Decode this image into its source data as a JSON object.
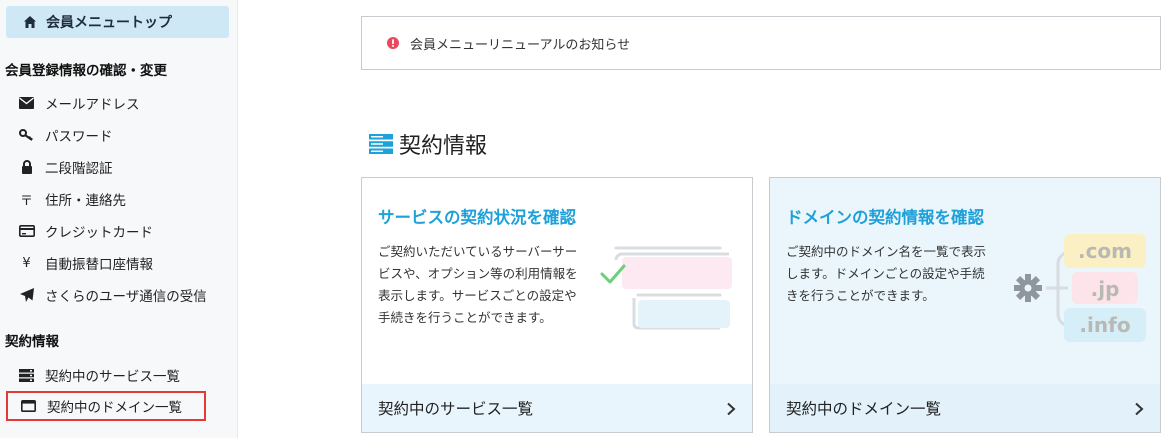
{
  "sidebar": {
    "top": {
      "label": "会員メニュートップ",
      "icon": "home-icon"
    },
    "sections": [
      {
        "heading": "会員登録情報の確認・変更"
      },
      {
        "heading": "契約情報"
      }
    ],
    "account_items": [
      {
        "label": "メールアドレス",
        "icon": "envelope-icon"
      },
      {
        "label": "パスワード",
        "icon": "key-icon"
      },
      {
        "label": "二段階認証",
        "icon": "lock-icon"
      },
      {
        "label": "住所・連絡先",
        "icon": "postal-mark-icon",
        "glyph": "〒"
      },
      {
        "label": "クレジットカード",
        "icon": "credit-card-icon"
      },
      {
        "label": "自動振替口座情報",
        "icon": "yen-icon",
        "glyph": "¥"
      },
      {
        "label": "さくらのユーザ通信の受信",
        "icon": "paper-plane-icon"
      }
    ],
    "contract_items": [
      {
        "label": "契約中のサービス一覧",
        "icon": "server-icon"
      },
      {
        "label": "契約中のドメイン一覧",
        "icon": "window-icon",
        "selected": true
      }
    ]
  },
  "notice": {
    "text": "会員メニューリニューアルのお知らせ",
    "icon": "exclamation-circle-icon",
    "color": "#e8495f"
  },
  "main": {
    "section_title": "契約情報",
    "cards": [
      {
        "title": "サービスの契約状況を確認",
        "description": "ご契約いただいているサーバーサービスや、オプション等の利用情報を表示します。サービスごとの設定や手続きを行うことができます。",
        "footer": "契約中のサービス一覧"
      },
      {
        "title": "ドメインの契約情報を確認",
        "description": "ご契約中のドメイン名を一覧で表示します。ドメインごとの設定や手続きを行うことができます。",
        "footer": "契約中のドメイン一覧",
        "illustration_labels": [
          ".com",
          ".jp",
          ".info"
        ]
      }
    ]
  },
  "colors": {
    "accent": "#1ea0d8",
    "highlight": "#e53935",
    "sidebar_active": "#cfe8f6"
  }
}
